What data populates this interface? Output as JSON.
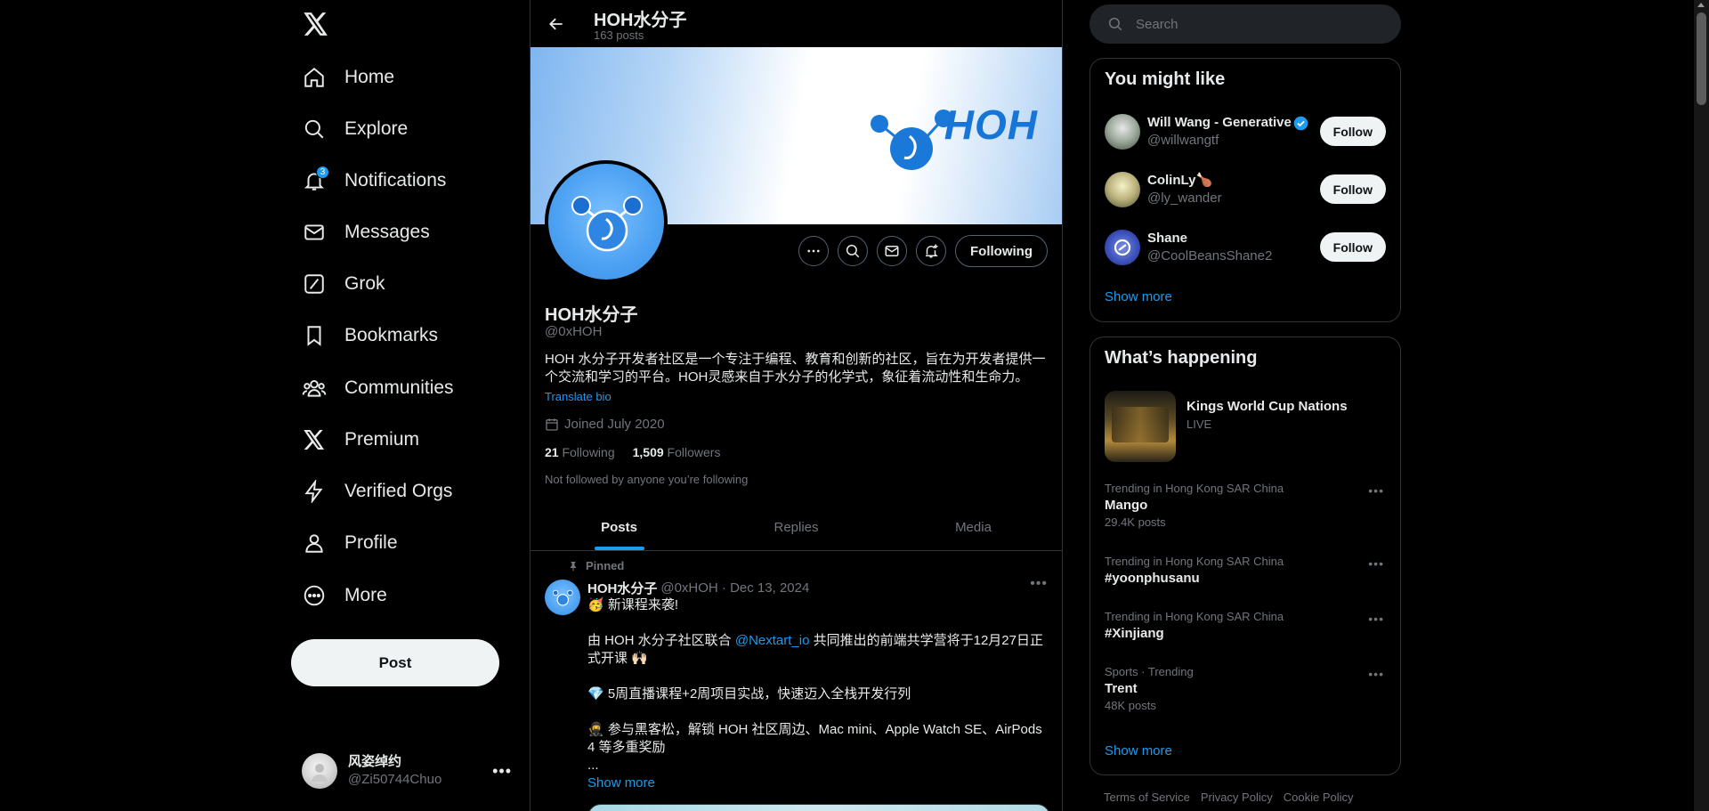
{
  "nav": {
    "items": [
      {
        "label": "Home",
        "icon": "home-icon"
      },
      {
        "label": "Explore",
        "icon": "search-icon"
      },
      {
        "label": "Notifications",
        "icon": "bell-icon",
        "badge": "3"
      },
      {
        "label": "Messages",
        "icon": "envelope-icon"
      },
      {
        "label": "Grok",
        "icon": "grok-icon"
      },
      {
        "label": "Bookmarks",
        "icon": "bookmark-icon"
      },
      {
        "label": "Communities",
        "icon": "people-icon"
      },
      {
        "label": "Premium",
        "icon": "x-logo-icon"
      },
      {
        "label": "Verified Orgs",
        "icon": "lightning-icon"
      },
      {
        "label": "Profile",
        "icon": "person-icon"
      },
      {
        "label": "More",
        "icon": "more-circle-icon"
      }
    ],
    "post_label": "Post"
  },
  "account": {
    "name": "风姿绰约",
    "handle": "@Zi50744Chuo"
  },
  "header": {
    "title": "HOH水分子",
    "posts_count": "163 posts"
  },
  "banner": {
    "wordmark": "HOH"
  },
  "profile": {
    "name": "HOH水分子",
    "handle": "@0xHOH",
    "bio": "HOH 水分子开发者社区是一个专注于编程、教育和创新的社区，旨在为开发者提供一个交流和学习的平台。HOH灵感来自于水分子的化学式，象征着流动性和生命力。",
    "translate_label": "Translate bio",
    "joined": "Joined July 2020",
    "following_count": "21",
    "following_label": "Following",
    "followers_count": "1,509",
    "followers_label": "Followers",
    "not_followed": "Not followed by anyone you’re following",
    "following_button": "Following"
  },
  "tabs": [
    "Posts",
    "Replies",
    "Media"
  ],
  "pinned_post": {
    "pinned_label": "Pinned",
    "author": "HOH水分子",
    "meta": "@0xHOH · Dec 13, 2024",
    "line1": "🥳 新课程来袭!",
    "line2_pre": "由 HOH 水分子社区联合 ",
    "line2_mention": "@Nextart_io",
    "line2_post": " 共同推出的前端共学营将于12月27日正式开课 🙌🏻",
    "line3": "💎 5周直播课程+2周项目实战，快速迈入全栈开发行列",
    "line4": "🥷 参与黑客松，解锁 HOH 社区周边、Mac mini、Apple Watch SE、AirPods 4 等多重奖励",
    "ellipsis": "...",
    "show_more": "Show more"
  },
  "search": {
    "placeholder": "Search"
  },
  "you_might_like": {
    "title": "You might like",
    "users": [
      {
        "name": "Will Wang - Generative",
        "handle": "@willwangtf",
        "verified": true,
        "button": "Follow"
      },
      {
        "name": "ColinLy🍗",
        "handle": "@ly_wander",
        "verified": false,
        "button": "Follow"
      },
      {
        "name": "Shane",
        "handle": "@CoolBeansShane2",
        "verified": false,
        "button": "Follow"
      }
    ],
    "show_more": "Show more"
  },
  "whats_happening": {
    "title": "What’s happening",
    "event": {
      "title": "Kings World Cup Nations",
      "status": "LIVE"
    },
    "trends": [
      {
        "context": "Trending in Hong Kong SAR China",
        "topic": "Mango",
        "count": "29.4K posts"
      },
      {
        "context": "Trending in Hong Kong SAR China",
        "topic": "#yoonphusanu",
        "count": ""
      },
      {
        "context": "Trending in Hong Kong SAR China",
        "topic": "#Xinjiang",
        "count": ""
      },
      {
        "context": "Sports · Trending",
        "topic": "Trent",
        "count": "48K posts"
      }
    ],
    "show_more": "Show more"
  },
  "footer": {
    "links": [
      "Terms of Service",
      "Privacy Policy",
      "Cookie Policy"
    ]
  },
  "colors": {
    "accent": "#1d9bf0",
    "background": "#000000",
    "text": "#e7e9ea",
    "muted": "#71767b",
    "border": "#2f3336"
  }
}
